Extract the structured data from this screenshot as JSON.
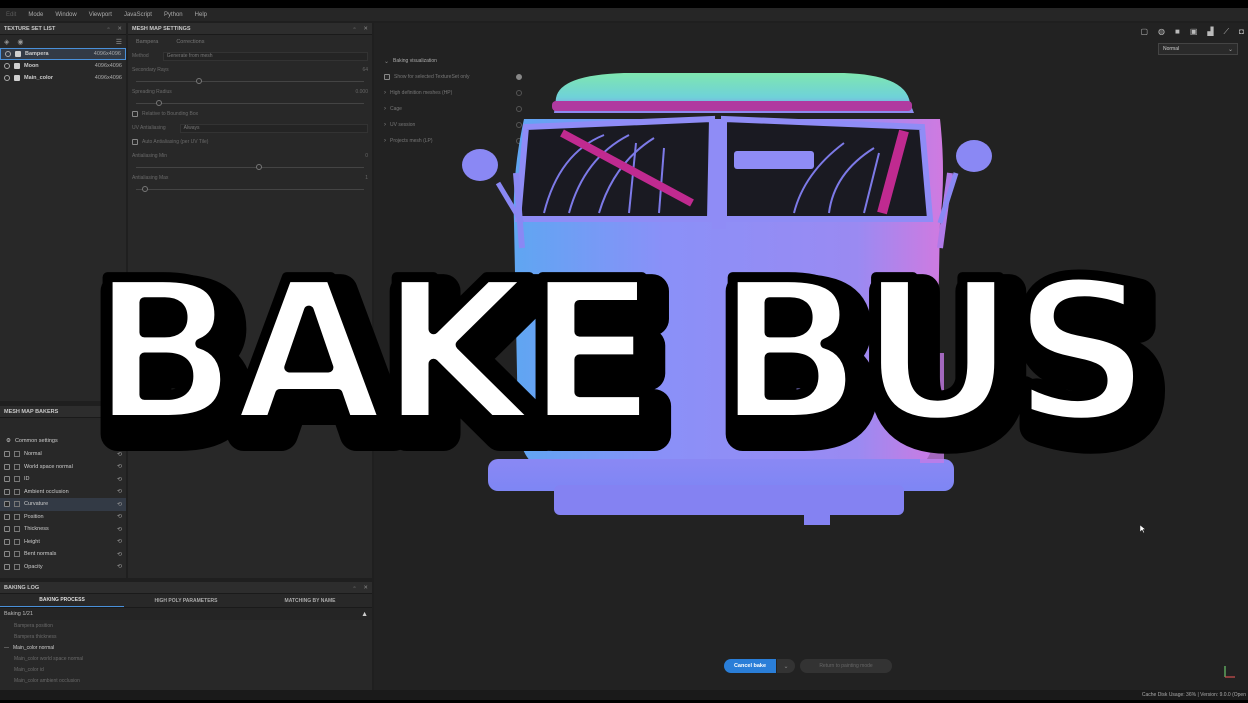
{
  "menu": {
    "items": [
      {
        "label": "Edit",
        "dim": true
      },
      {
        "label": "Mode",
        "dim": false
      },
      {
        "label": "Window",
        "dim": false
      },
      {
        "label": "Viewport",
        "dim": false
      },
      {
        "label": "JavaScript",
        "dim": false
      },
      {
        "label": "Python",
        "dim": false
      },
      {
        "label": "Help",
        "dim": false
      }
    ]
  },
  "texture_set_list": {
    "title": "TEXTURE SET LIST",
    "rows": [
      {
        "name": "Bampera",
        "res": "4096x4096",
        "selected": true
      },
      {
        "name": "Moon",
        "res": "4096x4096",
        "selected": false
      },
      {
        "name": "Main_color",
        "res": "4096x4096",
        "selected": false
      }
    ]
  },
  "mesh_map_settings": {
    "title": "MESH MAP SETTINGS",
    "tabs": [
      "Bampera",
      "Corrections"
    ],
    "method_label": "Method",
    "method_value": "Generate from mesh",
    "rows": [
      {
        "label": "Secondary Rays",
        "value": "64"
      },
      {
        "label": "Spreading Radius",
        "value": "0.000"
      },
      {
        "label": "Relative to Bounding Box",
        "value": ""
      },
      {
        "label": "UV Antialiasing",
        "value": "Always"
      },
      {
        "label": "Auto Antialiasing (per UV Tile)",
        "value": ""
      },
      {
        "label": "Antialiasing Min",
        "value": "0"
      },
      {
        "label": "Antialiasing Max",
        "value": "1"
      }
    ]
  },
  "mesh_map_bakers": {
    "title": "MESH MAP BAKERS",
    "common": "Common settings",
    "items": [
      {
        "label": "Normal",
        "selected": false
      },
      {
        "label": "World space normal",
        "selected": false
      },
      {
        "label": "ID",
        "selected": false
      },
      {
        "label": "Ambient occlusion",
        "selected": false
      },
      {
        "label": "Curvature",
        "selected": true
      },
      {
        "label": "Position",
        "selected": false
      },
      {
        "label": "Thickness",
        "selected": false
      },
      {
        "label": "Height",
        "selected": false
      },
      {
        "label": "Bent normals",
        "selected": false
      },
      {
        "label": "Opacity",
        "selected": false
      }
    ]
  },
  "baking_log": {
    "title": "BAKING LOG",
    "tabs": [
      "BAKING PROCESS",
      "HIGH POLY PARAMETERS",
      "MATCHING BY NAME"
    ],
    "status": "Baking 1/21",
    "lines": [
      {
        "text": "Bampera position",
        "current": false
      },
      {
        "text": "Bampera thickness",
        "current": false
      },
      {
        "text": "Main_color normal",
        "current": true
      },
      {
        "text": "Main_color world space normal",
        "current": false
      },
      {
        "text": "Main_color id",
        "current": false
      },
      {
        "text": "Main_color ambient occlusion",
        "current": false
      }
    ]
  },
  "viewport": {
    "view_mode": "Normal",
    "baking_visualization": {
      "title": "Baking visualization",
      "show_selected": "Show for selected TextureSet only",
      "sections": [
        "High definition meshes (HP)",
        "Cage",
        "UV session",
        "Projects mesh (LP)"
      ]
    },
    "cancel_label": "Cancel bake",
    "return_label": "Return to painting mode"
  },
  "overlay_title": "BAKE BUS",
  "status_bar": "Cache Disk Usage:   36% | Version: 9.0.0 (Open",
  "colors": {
    "accent": "#2a7ed8",
    "bus_top": "#7fe6b0",
    "bus_mid": "#8a8af8",
    "bus_side": "#c07ae8"
  }
}
